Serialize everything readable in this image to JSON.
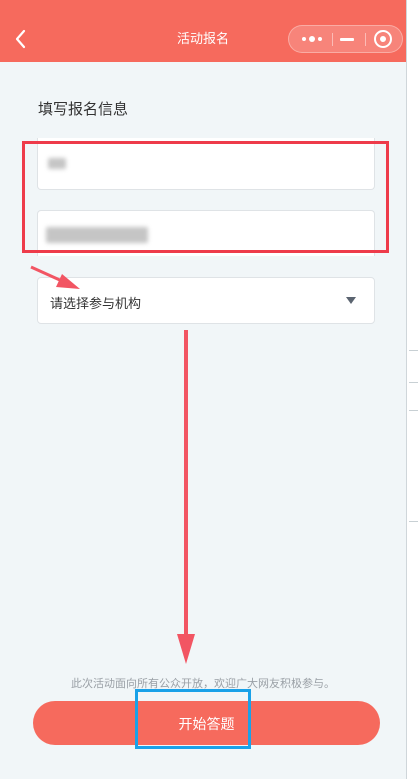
{
  "navbar": {
    "title": "活动报名",
    "bg_color": "#f66a5d"
  },
  "form": {
    "section_title": "填写报名信息",
    "name_value": "",
    "phone_value": "",
    "org_select_placeholder": "请选择参与机构"
  },
  "footer": {
    "notice": "此次活动面向所有公众开放，欢迎广大网友积极参与。",
    "start_button_label": "开始答题"
  },
  "annotations": {
    "fields_highlight_color": "#ee3b4a",
    "button_highlight_color": "#1aa1e8",
    "arrow_color": "#f25563"
  }
}
